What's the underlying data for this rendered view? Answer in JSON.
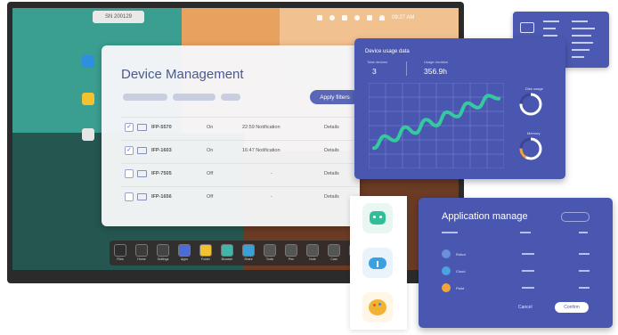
{
  "screen": {
    "sn_badge": "SN 200129",
    "status_time": "09:27 AM"
  },
  "device_management": {
    "title": "Device Management",
    "apply_button": "Apply filters",
    "rows": [
      {
        "name": "IFP-5570",
        "status": "On",
        "notification": "22:59 Notification",
        "action": "Details",
        "checked": true
      },
      {
        "name": "IFP-1603",
        "status": "On",
        "notification": "16:47 Notification",
        "action": "Details",
        "checked": true
      },
      {
        "name": "IFP-7505",
        "status": "Off",
        "notification": "-",
        "action": "Details",
        "checked": false
      },
      {
        "name": "IFP-1656",
        "status": "Off",
        "notification": "-",
        "action": "Details",
        "checked": false
      }
    ]
  },
  "dock": {
    "items": [
      {
        "label": "Files",
        "color": "#2e2e2e"
      },
      {
        "label": "Home",
        "color": "#3b3b3b"
      },
      {
        "label": "Settings",
        "color": "#444444"
      },
      {
        "label": "Apps",
        "color": "#4b6bd6"
      },
      {
        "label": "Folder",
        "color": "#f2c230"
      },
      {
        "label": "Browser",
        "color": "#3fb6a8"
      },
      {
        "label": "Share",
        "color": "#3aa0d8"
      },
      {
        "label": "Tools",
        "color": "#555555"
      },
      {
        "label": "Pen",
        "color": "#555555"
      },
      {
        "label": "Note",
        "color": "#555555"
      },
      {
        "label": "Cast",
        "color": "#555555"
      },
      {
        "label": "More",
        "color": "#555555"
      }
    ]
  },
  "usage_card": {
    "title": "Device usage data",
    "stat1_label": "Total devices",
    "stat1_value": "3",
    "stat2_label": "Usage duration",
    "stat2_value": "356.9h",
    "gauge1_label": "Disk usage",
    "gauge2_label": "Memory"
  },
  "chart_data": {
    "type": "line",
    "y": [
      0.2,
      0.36,
      0.3,
      0.48,
      0.4,
      0.58,
      0.5,
      0.68,
      0.62,
      0.8,
      0.74,
      0.9,
      0.86
    ],
    "grid": true,
    "color": "#35c9a0"
  },
  "app_manage": {
    "title": "Application manage",
    "rows": [
      {
        "name": "Robot",
        "color": "#6b8fd8"
      },
      {
        "name": "Cloud",
        "color": "#4aa3e0"
      },
      {
        "name": "Paint",
        "color": "#f0a63a"
      }
    ],
    "cancel_button": "Cancel",
    "confirm_button": "Confirm"
  }
}
